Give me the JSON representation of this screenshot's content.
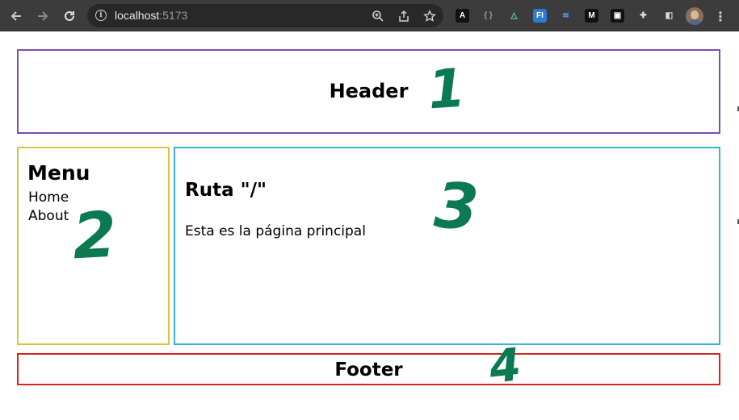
{
  "browser": {
    "url_host": "localhost",
    "url_port": ":5173",
    "nav_icons": [
      "back-arrow-icon",
      "forward-arrow-icon",
      "reload-icon"
    ],
    "omnibox_icons": [
      "site-info-icon",
      "zoom-icon",
      "share-icon",
      "bookmark-star-icon"
    ],
    "extensions": [
      {
        "name": "extension-a-icon",
        "glyph": "A",
        "color": "#ffffff",
        "bg": "#111111"
      },
      {
        "name": "extension-json-icon",
        "glyph": "{ }",
        "color": "#9a9a9a",
        "bg": "transparent"
      },
      {
        "name": "extension-triangle-icon",
        "glyph": "△",
        "color": "#6fd1c7",
        "bg": "transparent"
      },
      {
        "name": "extension-fi-icon",
        "glyph": "FI",
        "color": "#ffffff",
        "bg": "#2d7ad6"
      },
      {
        "name": "extension-waves-icon",
        "glyph": "≋",
        "color": "#4aa3f0",
        "bg": "transparent"
      },
      {
        "name": "extension-m-icon",
        "glyph": "M",
        "color": "#ffffff",
        "bg": "#111111"
      },
      {
        "name": "extension-square-icon",
        "glyph": "▣",
        "color": "#ffffff",
        "bg": "#111111"
      },
      {
        "name": "extensions-puzzle-icon",
        "glyph": "✚",
        "color": "#e0e0e0",
        "bg": "transparent"
      },
      {
        "name": "side-panel-icon",
        "glyph": "◧",
        "color": "#e0e0e0",
        "bg": "transparent"
      }
    ]
  },
  "page": {
    "header": {
      "title": "Header"
    },
    "menu": {
      "title": "Menu",
      "links": [
        "Home",
        "About"
      ]
    },
    "content": {
      "route_title": "Ruta \"/\"",
      "text": "Esta es la página principal"
    },
    "footer": {
      "title": "Footer"
    }
  },
  "annotations": [
    "1",
    "2",
    "3",
    "4"
  ],
  "colors": {
    "header_border": "#7b4fb5",
    "menu_border": "#d9c344",
    "content_border": "#39b2e1",
    "footer_border": "#d9241c",
    "annotation": "#0b7a52"
  }
}
